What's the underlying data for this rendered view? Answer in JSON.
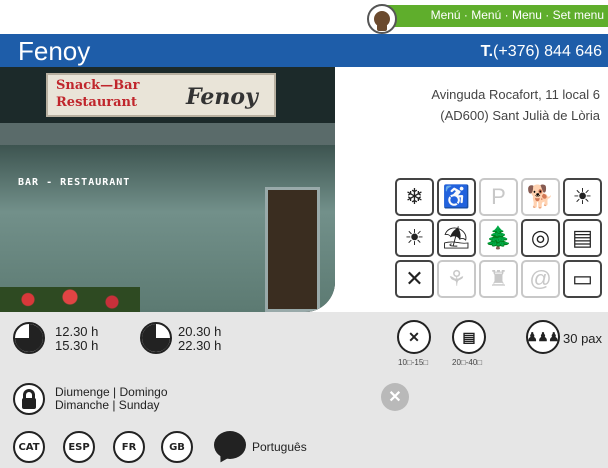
{
  "top": {
    "menu_links": "Menú · Menú · Menu · Set menu"
  },
  "header": {
    "name": "Fenoy",
    "phone_prefix": "T.",
    "phone_number": "(+376) 844 646"
  },
  "photo": {
    "sign_line1": "Snack—Bar",
    "sign_line2": "Restaurant",
    "sign_name": "Fenoy",
    "window_text": "BAR - RESTAURANT"
  },
  "address": {
    "line1": "Avinguda Rocafort, 11 local 6",
    "line2": "(AD600) Sant Julià de Lòria"
  },
  "amenities": {
    "row1": [
      {
        "icon": "snowflake-icon",
        "glyph": "❄",
        "active": true
      },
      {
        "icon": "wheelchair-icon",
        "glyph": "♿",
        "active": true
      },
      {
        "icon": "parking-icon",
        "glyph": "P",
        "active": false
      },
      {
        "icon": "no-pets-icon",
        "glyph": "🐕",
        "active": false
      },
      {
        "icon": "no-smoking-sun-icon",
        "glyph": "☀",
        "active": true
      }
    ],
    "row2": [
      {
        "icon": "terrace-sun-icon",
        "glyph": "☀",
        "active": true
      },
      {
        "icon": "garden-icon",
        "glyph": "⛱",
        "active": true
      },
      {
        "icon": "trees-icon",
        "glyph": "🌲",
        "active": false
      },
      {
        "icon": "kids-area-icon",
        "glyph": "◎",
        "active": true
      },
      {
        "icon": "menu-book-icon",
        "glyph": "▤",
        "active": true
      }
    ],
    "row3": [
      {
        "icon": "cutlery-icon",
        "glyph": "✕",
        "active": true
      },
      {
        "icon": "gluten-free-icon",
        "glyph": "⚘",
        "active": false
      },
      {
        "icon": "cook-icon",
        "glyph": "♜",
        "active": false
      },
      {
        "icon": "at-icon",
        "glyph": "@",
        "active": false
      },
      {
        "icon": "credit-card-icon",
        "glyph": "▭",
        "active": true
      }
    ]
  },
  "hours": {
    "lunch_open": "12.30 h",
    "lunch_close": "15.30 h",
    "dinner_open": "20.30 h",
    "dinner_close": "22.30 h"
  },
  "prices": {
    "menu_price": "10□-15□",
    "carta_price": "20□-40□"
  },
  "capacity": "30 pax",
  "closed_days": {
    "line1": "Diumenge | Domingo",
    "line2": "Dimanche | Sunday"
  },
  "languages": {
    "cat": "CAT",
    "esp": "ESP",
    "fr": "FR",
    "gb": "GB",
    "other": "Português"
  },
  "colors": {
    "brand_blue": "#1e5da9",
    "menu_green": "#5fae2c",
    "info_gray": "#e6e6e6"
  }
}
